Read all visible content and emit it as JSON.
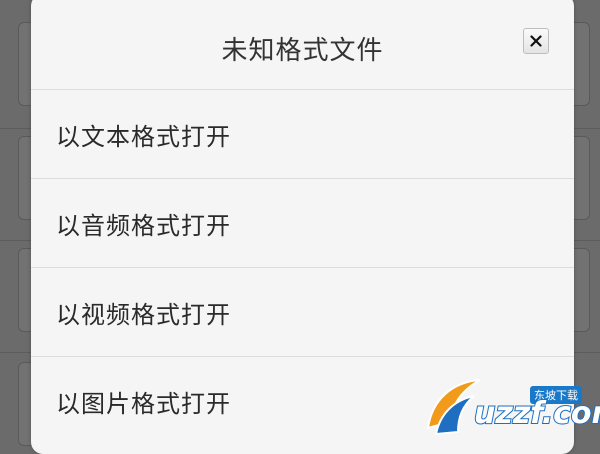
{
  "dialog": {
    "title": "未知格式文件",
    "close_icon": "close-icon",
    "options": [
      {
        "label": "以文本格式打开"
      },
      {
        "label": "以音频格式打开"
      },
      {
        "label": "以视频格式打开"
      },
      {
        "label": "以图片格式打开"
      }
    ]
  },
  "watermark": {
    "sub": "东坡下载",
    "main": "uzzf.com"
  },
  "colors": {
    "overlay": "#6b6b6b",
    "dialog_bg": "#f5f5f5",
    "divider": "#dcdcdc",
    "text": "#333333",
    "brand_blue": "#1e6fc1",
    "brand_orange": "#f29a1a"
  }
}
